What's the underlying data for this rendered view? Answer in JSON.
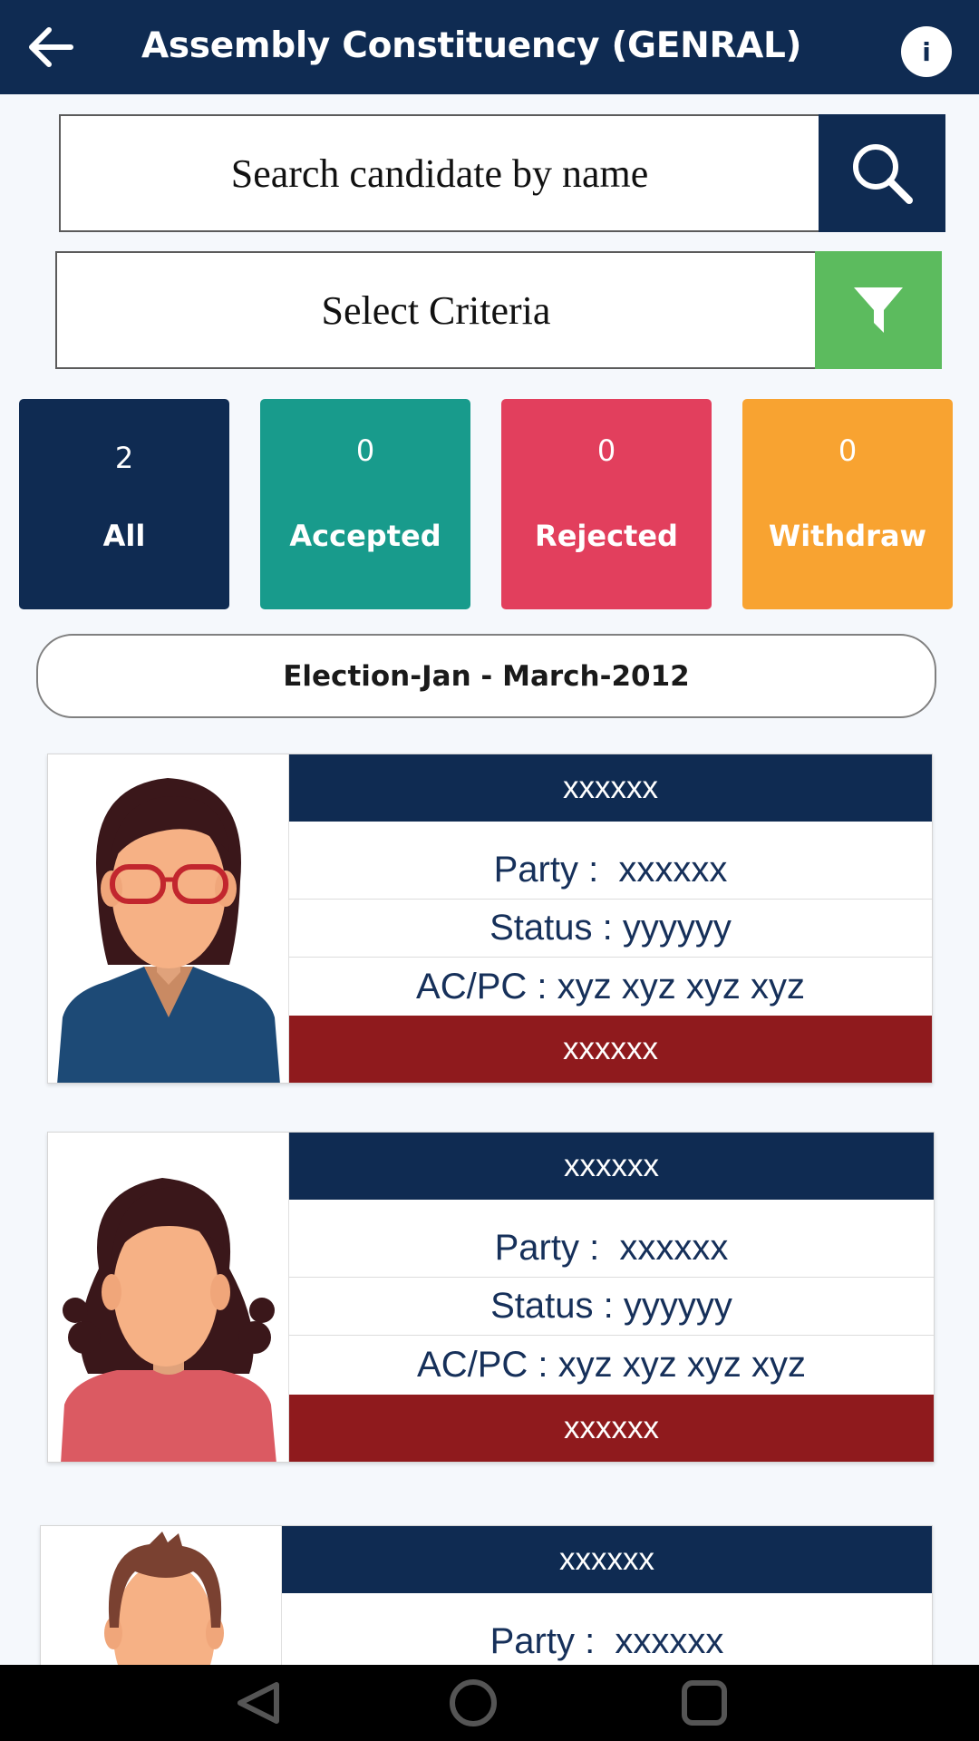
{
  "header": {
    "title": "Assembly Constituency (GENRAL)",
    "info_label": "i"
  },
  "search": {
    "placeholder": "Search candidate by name"
  },
  "criteria": {
    "label": "Select Criteria"
  },
  "stats": [
    {
      "count": "2",
      "label": "All",
      "color": "#0f2b52"
    },
    {
      "count": "0",
      "label": "Accepted",
      "color": "#189b8c"
    },
    {
      "count": "0",
      "label": "Rejected",
      "color": "#e23f5d"
    },
    {
      "count": "0",
      "label": "Withdraw",
      "color": "#f8a331"
    }
  ],
  "election": {
    "label": "Election-Jan - March-2012"
  },
  "candidates": [
    {
      "name": "xxxxxx",
      "party": "Party :  xxxxxx",
      "status": "Status : yyyyyy",
      "acpc": "AC/PC : xyz xyz xyz xyz",
      "footer": "xxxxxx",
      "avatar": "woman-glasses-avatar"
    },
    {
      "name": "xxxxxx",
      "party": "Party :  xxxxxx",
      "status": "Status : yyyyyy",
      "acpc": "AC/PC : xyz xyz xyz xyz",
      "footer": "xxxxxx",
      "avatar": "woman-curly-hair-avatar"
    },
    {
      "name": "xxxxxx",
      "party": "Party :  xxxxxx",
      "avatar": "man-avatar"
    }
  ],
  "navbar": {
    "items": [
      "back-triangle-icon",
      "home-circle-icon",
      "recents-square-icon"
    ]
  }
}
